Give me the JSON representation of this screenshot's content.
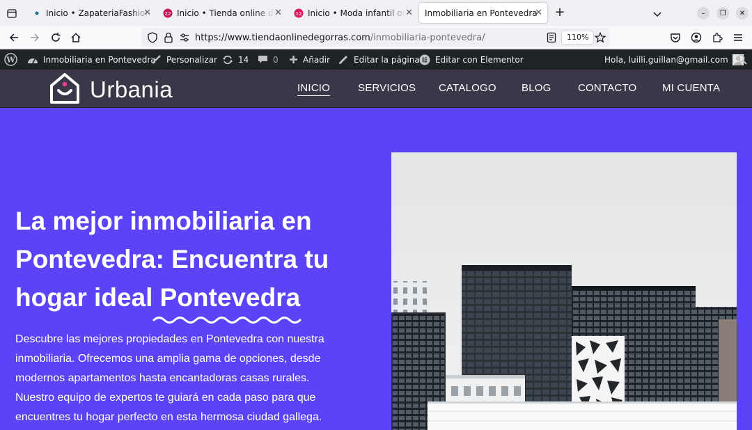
{
  "browser": {
    "tabs": [
      {
        "title": "Inicio • ZapateriaFashion",
        "favicon": "page-dot-icon",
        "active": false
      },
      {
        "title": "Inicio • Tienda online de g",
        "favicon": "site-logo-icon",
        "active": false
      },
      {
        "title": "Inicio • Moda infantil onli",
        "favicon": "site-logo-icon",
        "active": false
      },
      {
        "title": "Inmobiliaria en Pontevedra",
        "favicon": "",
        "active": true
      }
    ],
    "url_host": "https://www.tiendaonlinedegorras.com",
    "url_path": "/inmobiliaria-pontevedra/",
    "zoom": "110%"
  },
  "adminbar": {
    "site_name": "Inmobiliaria en Pontevedra",
    "customize": "Personalizar",
    "updates_count": "14",
    "comments_count": "0",
    "add_new": "Añadir",
    "edit_page": "Editar la página",
    "edit_elementor": "Editar con Elementor",
    "greeting": "Hola, luilli.guillan@gmail.com"
  },
  "site": {
    "logo_text": "Urbania",
    "menu": [
      "INICIO",
      "SERVICIOS",
      "CATALOGO",
      "BLOG",
      "CONTACTO",
      "MI CUENTA"
    ]
  },
  "hero": {
    "title_part1": "La mejor inmobiliaria en Pontevedra: Encuentra tu hogar ideal ",
    "title_highlight": "Pontevedra",
    "paragraph": "Descubre las mejores propiedades en Pontevedra con nuestra inmobiliaria. Ofrecemos una amplia gama de opciones, desde modernos apartamentos hasta encantadoras casas rurales. Nuestro equipo de expertos te guiará en cada paso para que encuentres tu hogar perfecto en esta hermosa ciudad gallega."
  },
  "colors": {
    "hero_bg": "#5b44f8",
    "header_bg": "#3b3749",
    "adminbar_bg": "#1d2327",
    "logo_accent": "#e84393"
  }
}
